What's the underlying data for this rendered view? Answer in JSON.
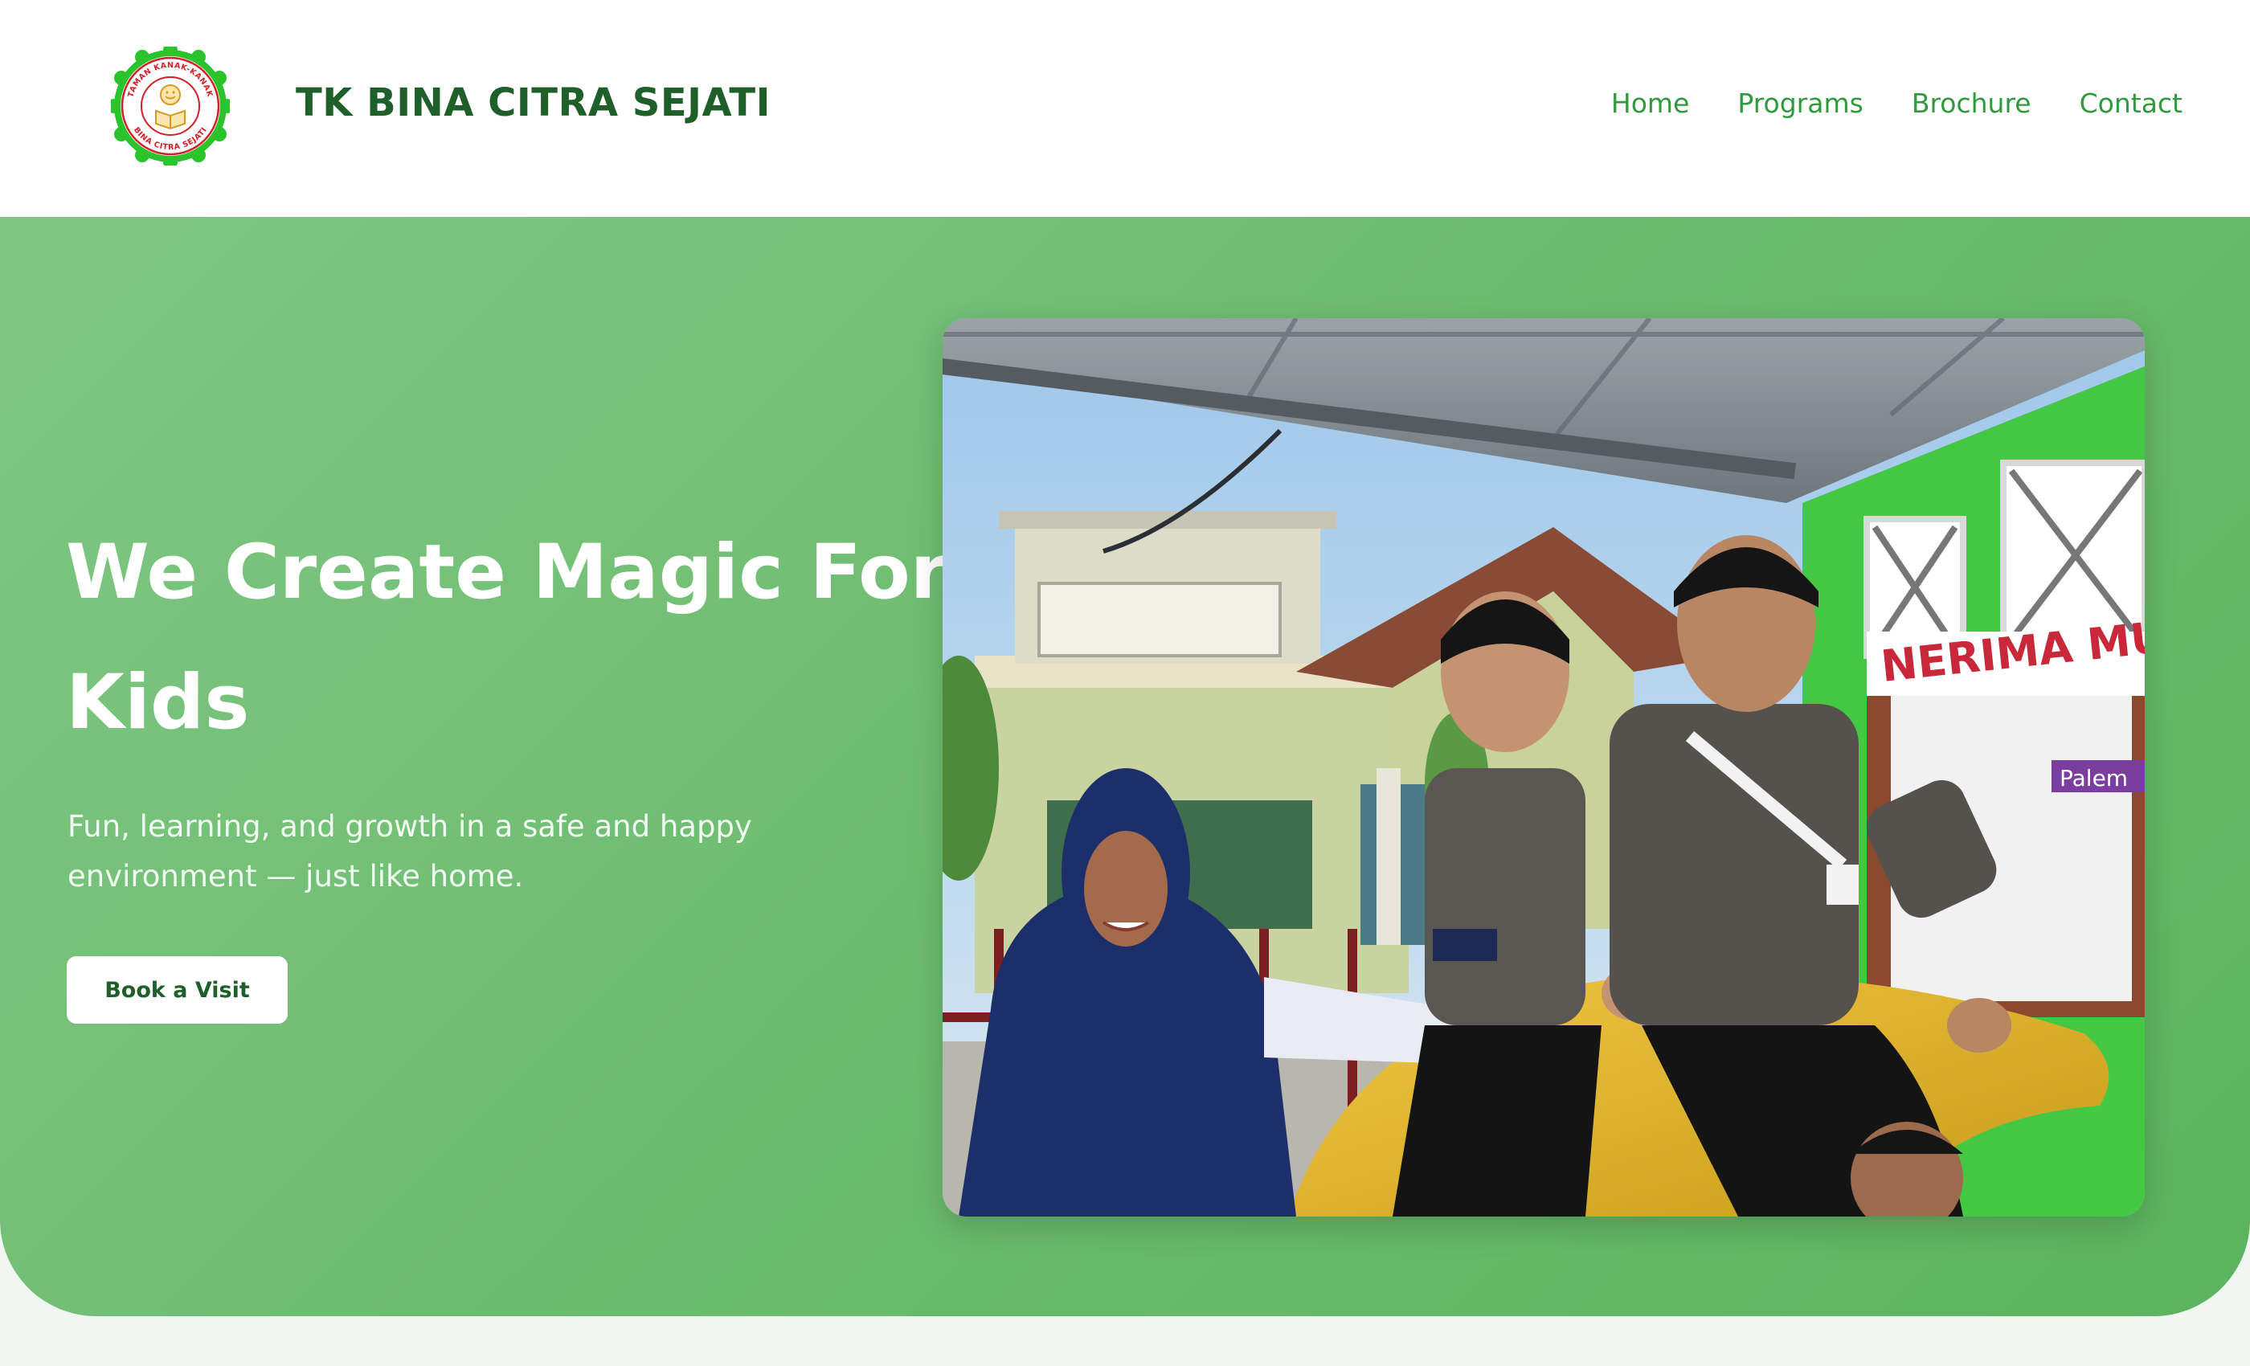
{
  "header": {
    "brand_name": "TK BINA CITRA SEJATI",
    "logo": {
      "icon": "school-logo-icon",
      "ring_text_top": "TAMAN KANAK-KANAK",
      "ring_text_bottom": "BINA CITRA SEJATI"
    },
    "nav": [
      {
        "label": "Home"
      },
      {
        "label": "Programs"
      },
      {
        "label": "Brochure"
      },
      {
        "label": "Contact"
      }
    ]
  },
  "hero": {
    "title": "We Create Magic For Kids",
    "subtitle": "Fun, learning, and growth in a safe and happy environment — just like home.",
    "cta_label": "Book a Visit",
    "photo": {
      "sign_text": "NERIMA MURID",
      "sign_text_2": "Palem"
    }
  },
  "colors": {
    "brand_dark_green": "#1f5f2a",
    "nav_green": "#2f9a3e",
    "hero_green_light": "#80c784",
    "hero_green_dark": "#5cb45f",
    "wall_green": "#44c844"
  }
}
